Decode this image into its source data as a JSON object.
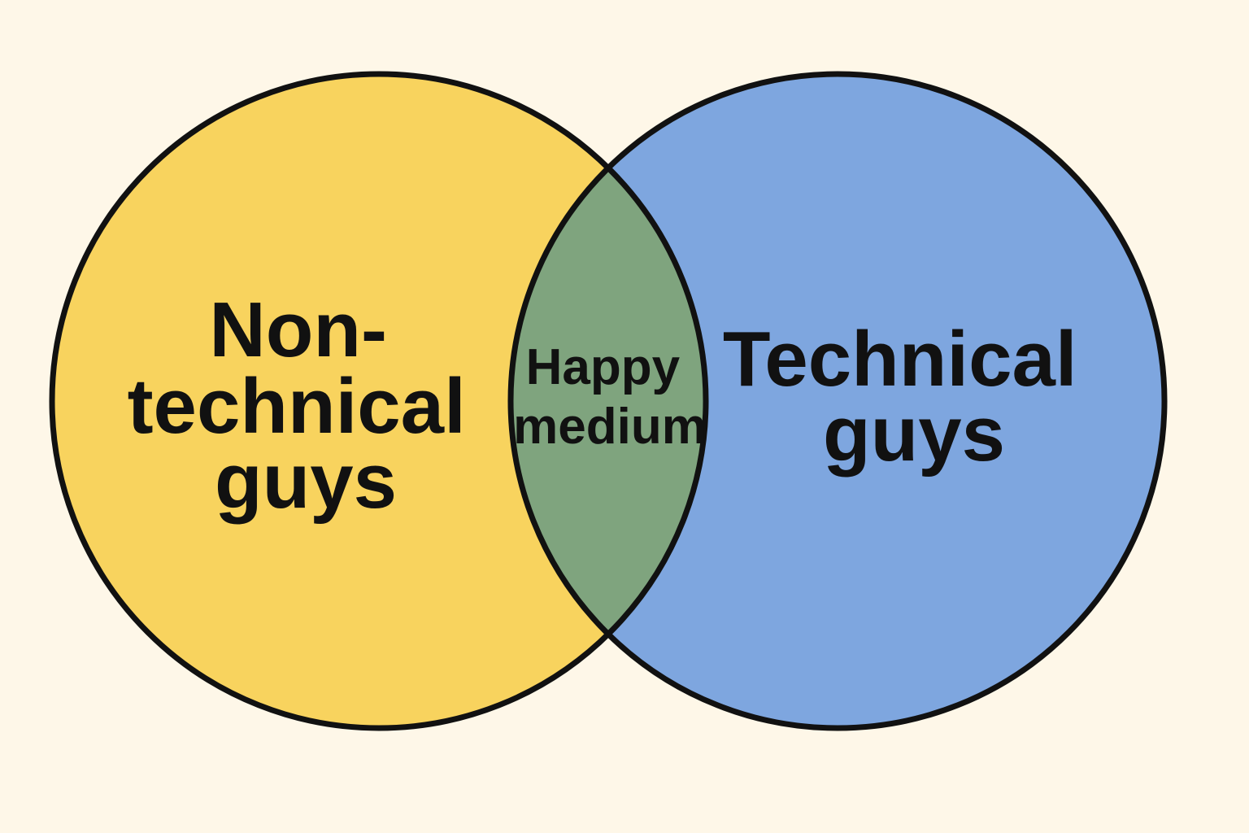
{
  "diagram": {
    "type": "venn",
    "background_color": "#FEF7E8",
    "outline_color": "#111111",
    "sets": [
      {
        "id": "left",
        "label_lines": [
          "Non-",
          "technical",
          "guys"
        ],
        "fill_color": "#F8D35E"
      },
      {
        "id": "right",
        "label_lines": [
          "Technical",
          "guys"
        ],
        "fill_color": "#7EA6DF"
      }
    ],
    "intersection": {
      "label_lines": [
        "Happy",
        "medium"
      ],
      "fill_color": "#7FA47E"
    }
  }
}
